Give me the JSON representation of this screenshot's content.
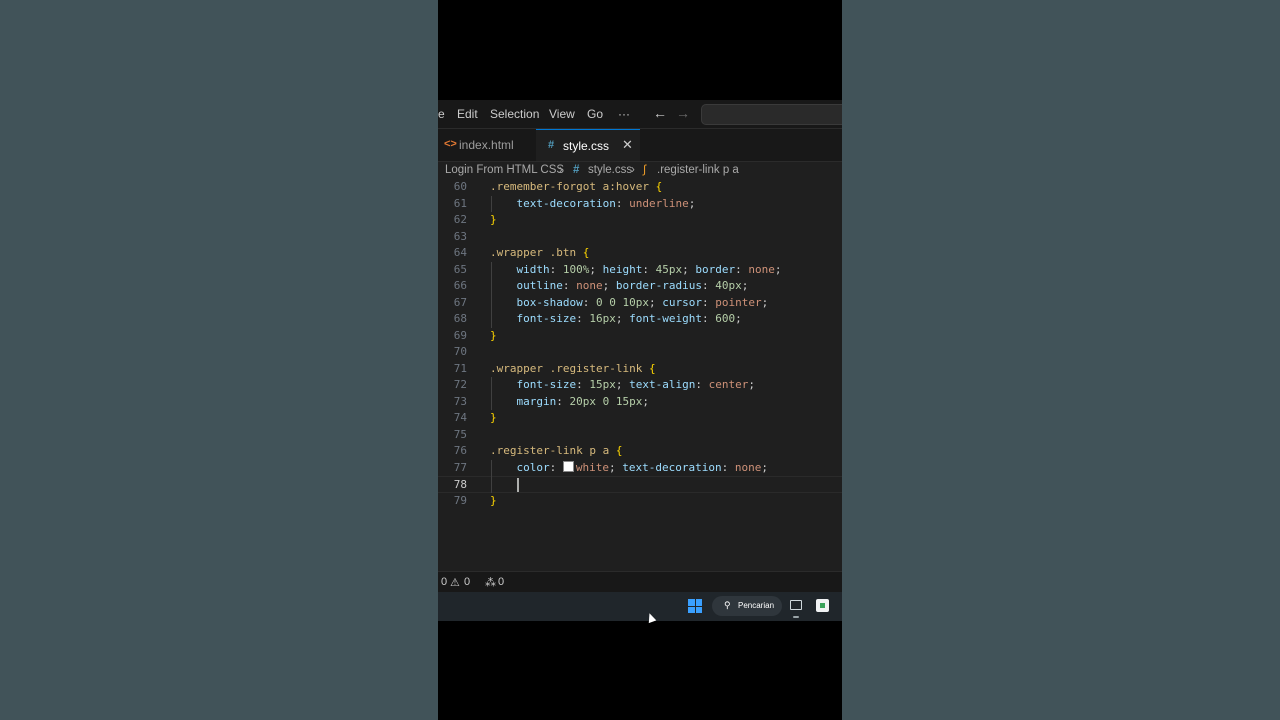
{
  "menubar": {
    "items": [
      "e",
      "Edit",
      "Selection",
      "View",
      "Go",
      "···"
    ],
    "back_icon": "arrow-left-icon",
    "forward_icon": "arrow-right-icon"
  },
  "tabs": [
    {
      "label": "index.html",
      "icon": "<>",
      "active": false
    },
    {
      "label": "style.css",
      "icon": "#",
      "active": true,
      "close": "✕"
    }
  ],
  "breadcrumb": {
    "folder": "Login From HTML CSS",
    "file_icon": "#",
    "file": "style.css",
    "symbol": ".register-link p a"
  },
  "editor": {
    "current_line": 78,
    "lines": [
      {
        "num": "60",
        "code": ".remember-forgot a:hover {"
      },
      {
        "num": "61",
        "code": "    text-decoration: underline;"
      },
      {
        "num": "62",
        "code": "}"
      },
      {
        "num": "63",
        "code": ""
      },
      {
        "num": "64",
        "code": ".wrapper .btn {"
      },
      {
        "num": "65",
        "code": "    width: 100%; height: 45px; border: none;"
      },
      {
        "num": "66",
        "code": "    outline: none; border-radius: 40px;"
      },
      {
        "num": "67",
        "code": "    box-shadow: 0 0 10px; cursor: pointer;"
      },
      {
        "num": "68",
        "code": "    font-size: 16px; font-weight: 600;"
      },
      {
        "num": "69",
        "code": "}"
      },
      {
        "num": "70",
        "code": ""
      },
      {
        "num": "71",
        "code": ".wrapper .register-link {"
      },
      {
        "num": "72",
        "code": "    font-size: 15px; text-align: center;"
      },
      {
        "num": "73",
        "code": "    margin: 20px 0 15px;"
      },
      {
        "num": "74",
        "code": "}"
      },
      {
        "num": "75",
        "code": ""
      },
      {
        "num": "76",
        "code": ".register-link p a {"
      },
      {
        "num": "77",
        "code": "    color: white; text-decoration: none;"
      },
      {
        "num": "78",
        "code": "    "
      },
      {
        "num": "79",
        "code": "}"
      }
    ]
  },
  "statusbar": {
    "errors": "0",
    "warnings": "0",
    "ports": "0"
  },
  "taskbar": {
    "search_label": "Pencarian"
  },
  "colors": {
    "background": "#415359",
    "editor_bg": "#1f1f1f",
    "accent": "#0078d4",
    "selector": "#d7ba7d",
    "property": "#9cdcfe",
    "number": "#b5cea8",
    "value": "#ce9178"
  }
}
